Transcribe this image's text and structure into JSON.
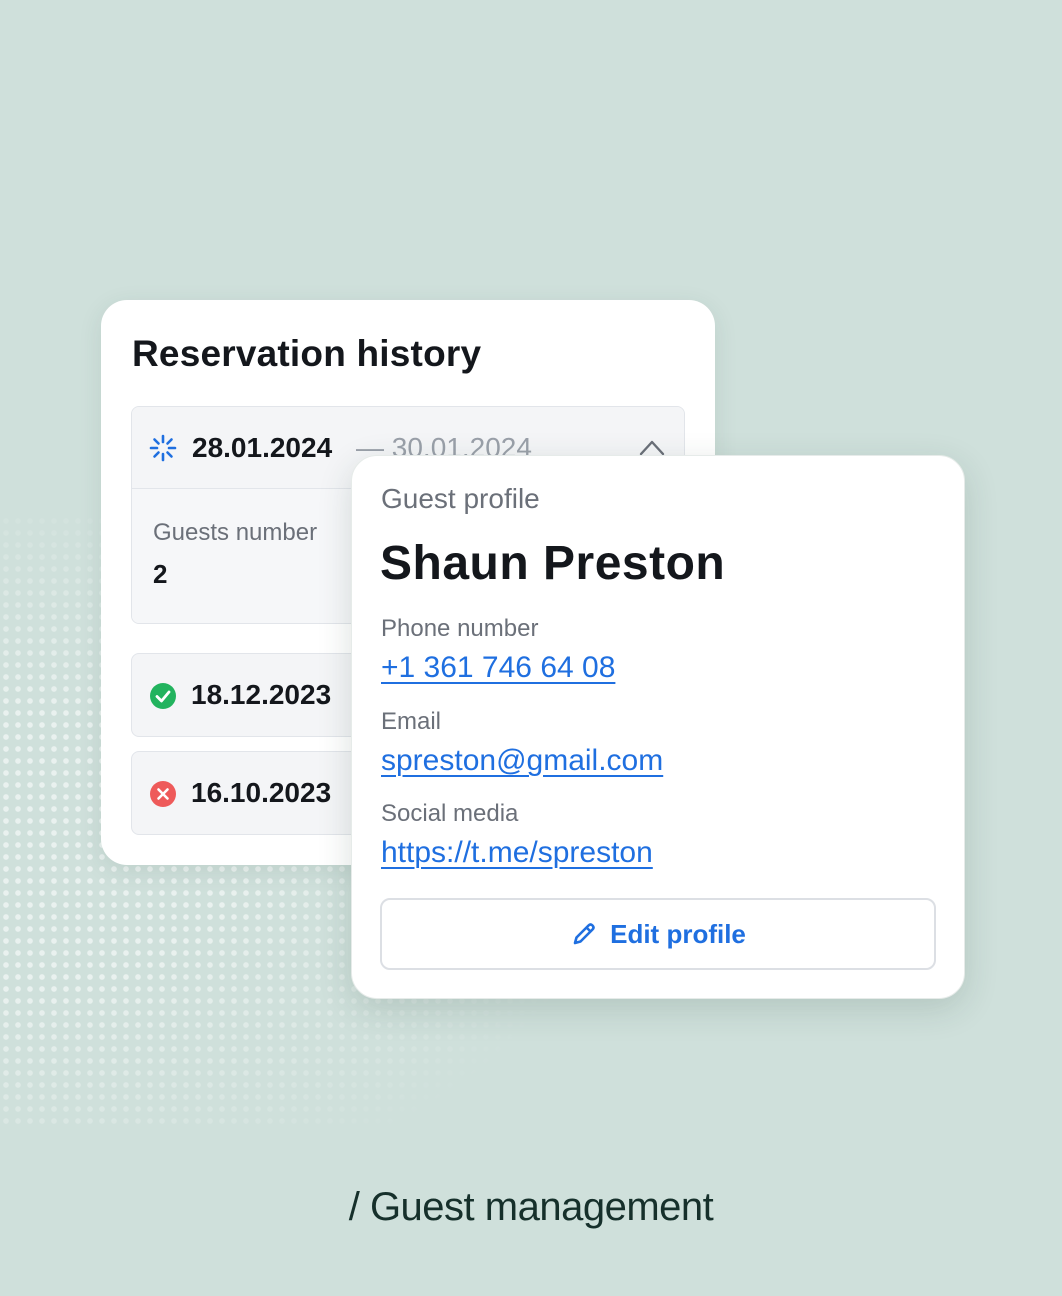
{
  "colors": {
    "background": "#cfe0db",
    "link": "#1f6fe0",
    "status_success": "#22b35e",
    "status_cancelled": "#ee5a5a",
    "status_pending": "#1f6fe0"
  },
  "reservation_history": {
    "title": "Reservation history",
    "open_reservation": {
      "status_icon": "spinner-icon",
      "start_date": "28.01.2024",
      "end_date": "— 30.01.2024",
      "guests_label": "Guests number",
      "guests_value": "2"
    },
    "rows": [
      {
        "status_icon": "check-circle-icon",
        "date": "18.12.2023"
      },
      {
        "status_icon": "x-circle-icon",
        "date": "16.10.2023"
      }
    ]
  },
  "guest_profile": {
    "subtitle": "Guest profile",
    "name": "Shaun Preston",
    "phone_label": "Phone number",
    "phone": "+1 361 746 64 08",
    "email_label": "Email",
    "email": "spreston@gmail.com",
    "social_label": "Social media",
    "social": "https://t.me/spreston",
    "edit_button": "Edit profile"
  },
  "caption": "/ Guest management"
}
